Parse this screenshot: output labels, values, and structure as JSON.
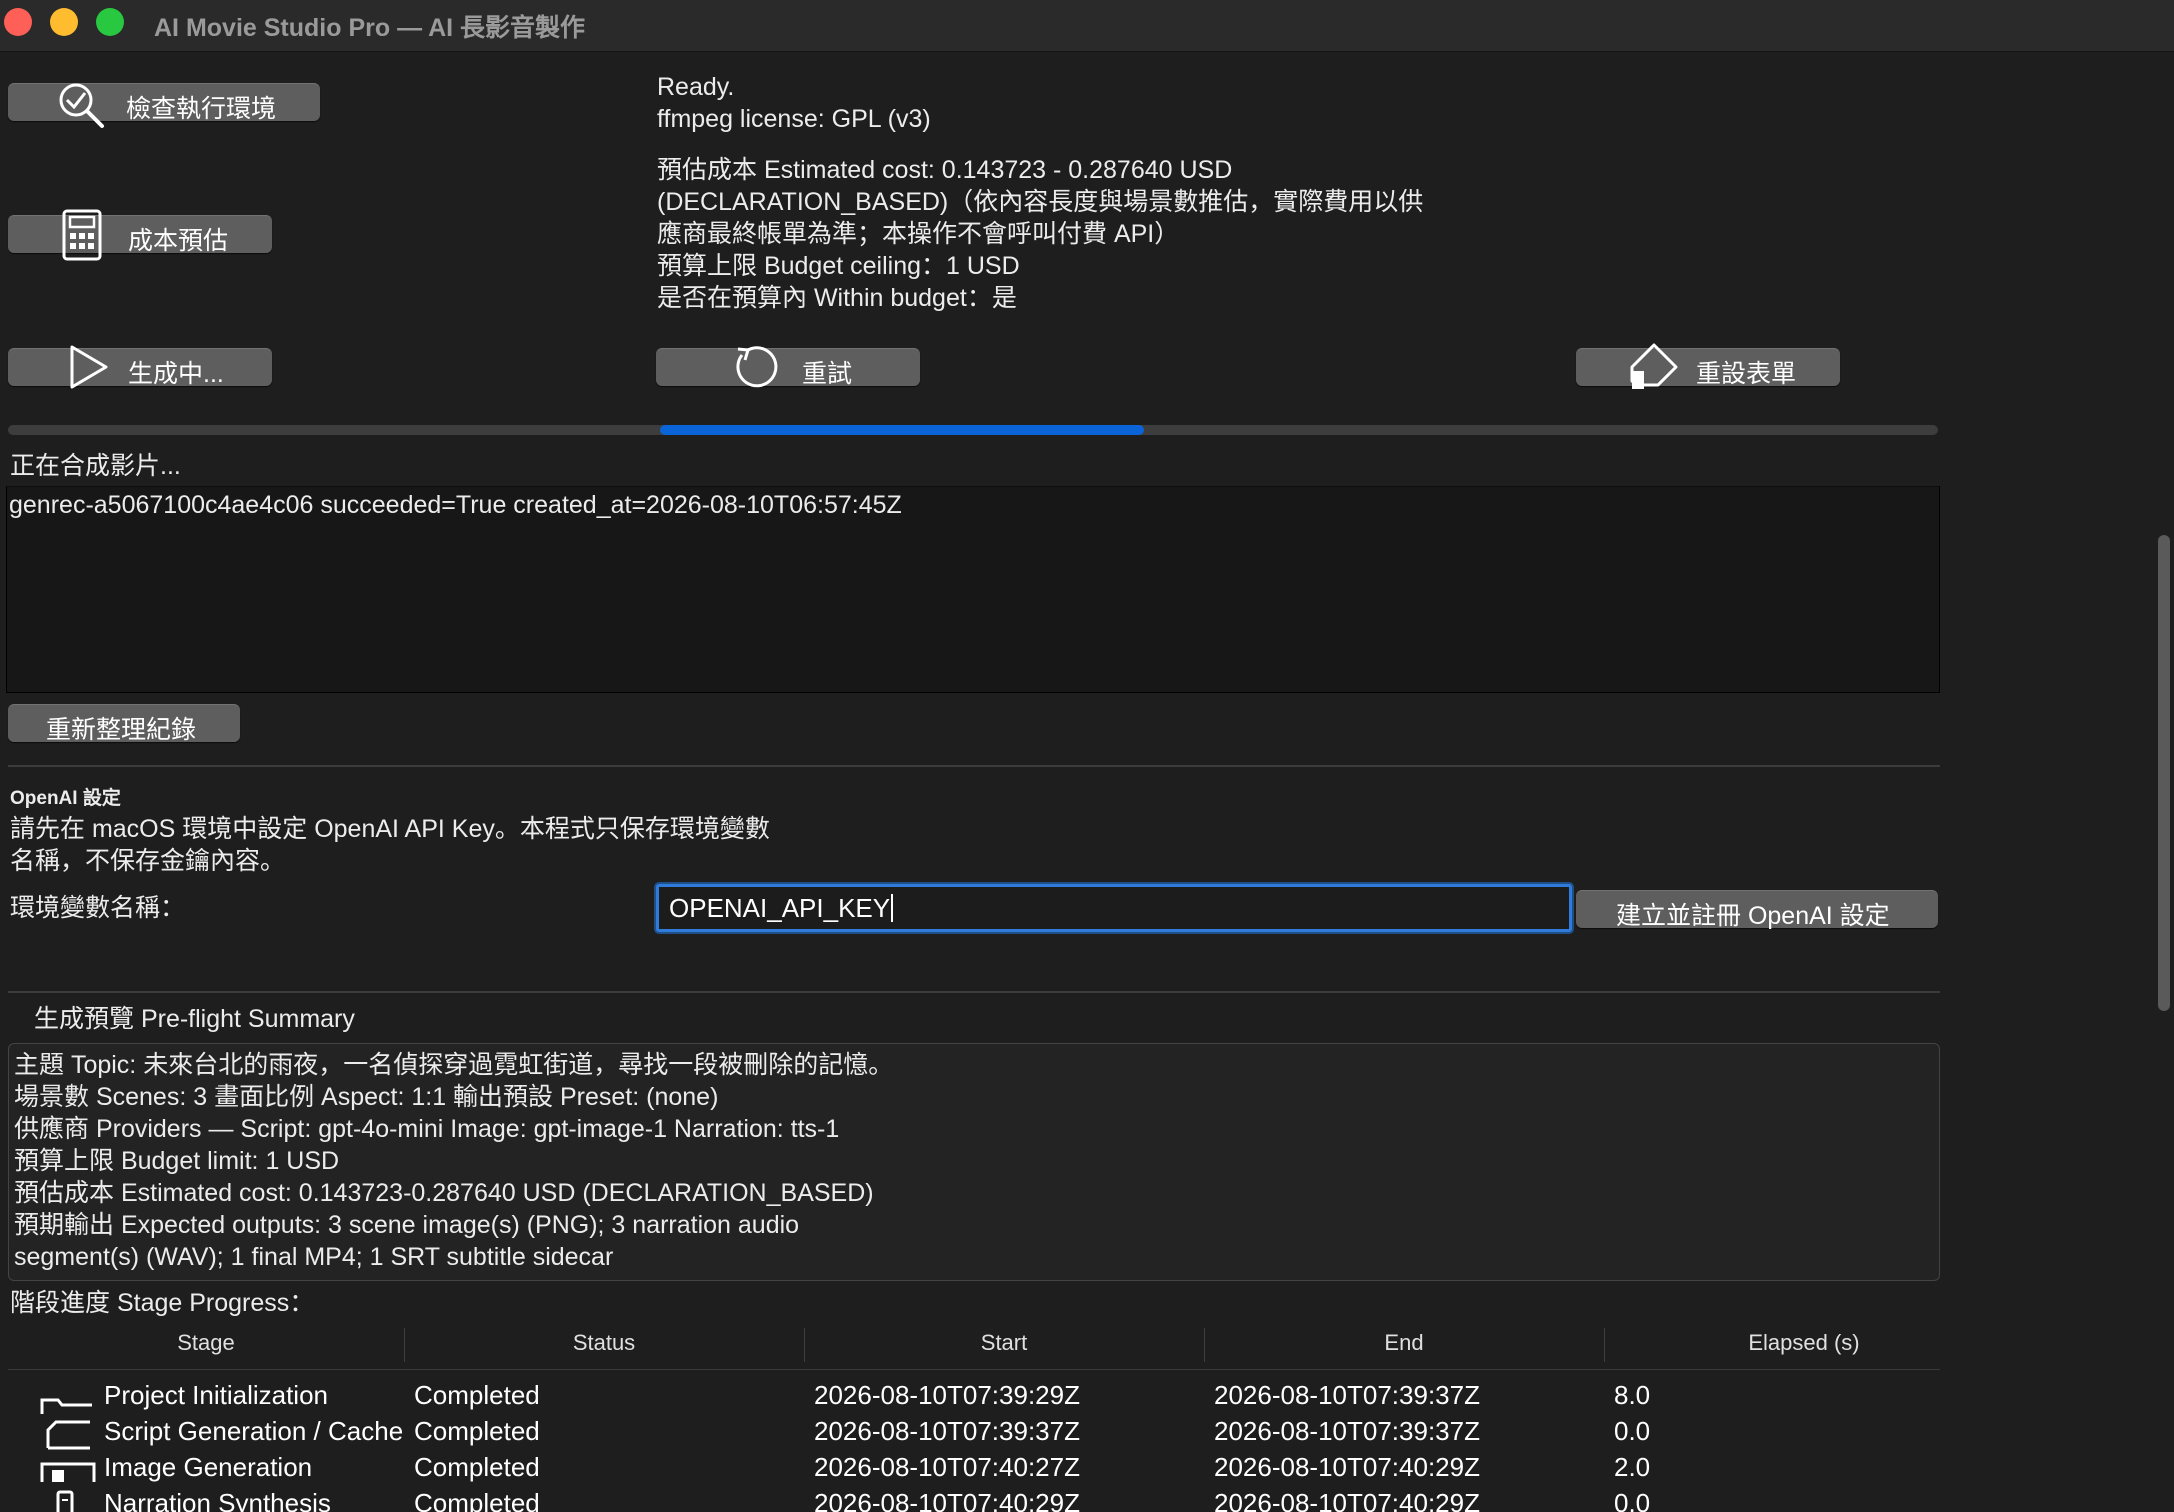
{
  "window": {
    "title": "AI Movie Studio Pro — AI 長影音製作"
  },
  "toolbar": {
    "check_env_label": "檢查執行環境",
    "cost_estimate_label": "成本預估",
    "generate_label": "生成中...",
    "retry_label": "重試",
    "reset_form_label": "重設表單"
  },
  "status": {
    "ready": "Ready.",
    "license": "ffmpeg license: GPL (v3)",
    "cost_line1": "預估成本 Estimated cost: 0.143723 - 0.287640 USD",
    "cost_line2": "(DECLARATION_BASED)（依內容長度與場景數推估，實際費用以供",
    "cost_line3": "應商最終帳單為準；本操作不會呼叫付費 API）",
    "budget_ceiling": "預算上限 Budget ceiling：1 USD",
    "within_budget": "是否在預算內 Within budget：是"
  },
  "progress": {
    "value_start_fraction": 0.338,
    "value_end_fraction": 0.589,
    "label": "正在合成影片..."
  },
  "log": {
    "entries": [
      "genrec-a5067100c4ae4c06  succeeded=True  created_at=2026-08-10T06:57:45Z"
    ],
    "refresh_label": "重新整理紀錄"
  },
  "openai": {
    "section_title": "OpenAI 設定",
    "desc_line1": "請先在 macOS 環境中設定 OpenAI API Key。本程式只保存環境變數",
    "desc_line2": "名稱，不保存金鑰內容。",
    "env_label": "環境變數名稱：",
    "env_value": "OPENAI_API_KEY",
    "create_button_label": "建立並註冊 OpenAI 設定"
  },
  "preflight": {
    "title": "生成預覽 Pre-flight Summary",
    "lines": [
      "主題 Topic: 未來台北的雨夜，一名偵探穿過霓虹街道，尋找一段被刪除的記憶。",
      "場景數 Scenes: 3    畫面比例 Aspect: 1:1    輸出預設 Preset: (none)",
      "供應商 Providers — Script: gpt-4o-mini  Image: gpt-image-1  Narration: tts-1",
      "預算上限 Budget limit: 1 USD",
      "預估成本 Estimated cost: 0.143723-0.287640 USD (DECLARATION_BASED)",
      "預期輸出 Expected outputs: 3 scene image(s) (PNG); 3 narration audio",
      "segment(s) (WAV); 1 final MP4; 1 SRT subtitle sidecar"
    ]
  },
  "stages": {
    "title": "階段進度 Stage Progress：",
    "columns": [
      "Stage",
      "Status",
      "Start",
      "End",
      "Elapsed (s)"
    ],
    "rows": [
      {
        "icon": "folder-icon",
        "stage": "Project Initialization",
        "status": "Completed",
        "start": "2026-08-10T07:39:29Z",
        "end": "2026-08-10T07:39:37Z",
        "elapsed": "8.0"
      },
      {
        "icon": "script-icon",
        "stage": "Script Generation / Cache",
        "status": "Completed",
        "start": "2026-08-10T07:39:37Z",
        "end": "2026-08-10T07:39:37Z",
        "elapsed": "0.0"
      },
      {
        "icon": "image-icon",
        "stage": "Image Generation",
        "status": "Completed",
        "start": "2026-08-10T07:40:27Z",
        "end": "2026-08-10T07:40:29Z",
        "elapsed": "2.0"
      },
      {
        "icon": "audio-icon",
        "stage": "Narration Synthesis",
        "status": "Completed",
        "start": "2026-08-10T07:40:29Z",
        "end": "2026-08-10T07:40:29Z",
        "elapsed": "0.0"
      }
    ]
  },
  "colors": {
    "accent": "#0a64d8",
    "background": "#1e1e1e",
    "button": "#5e5e5e"
  }
}
